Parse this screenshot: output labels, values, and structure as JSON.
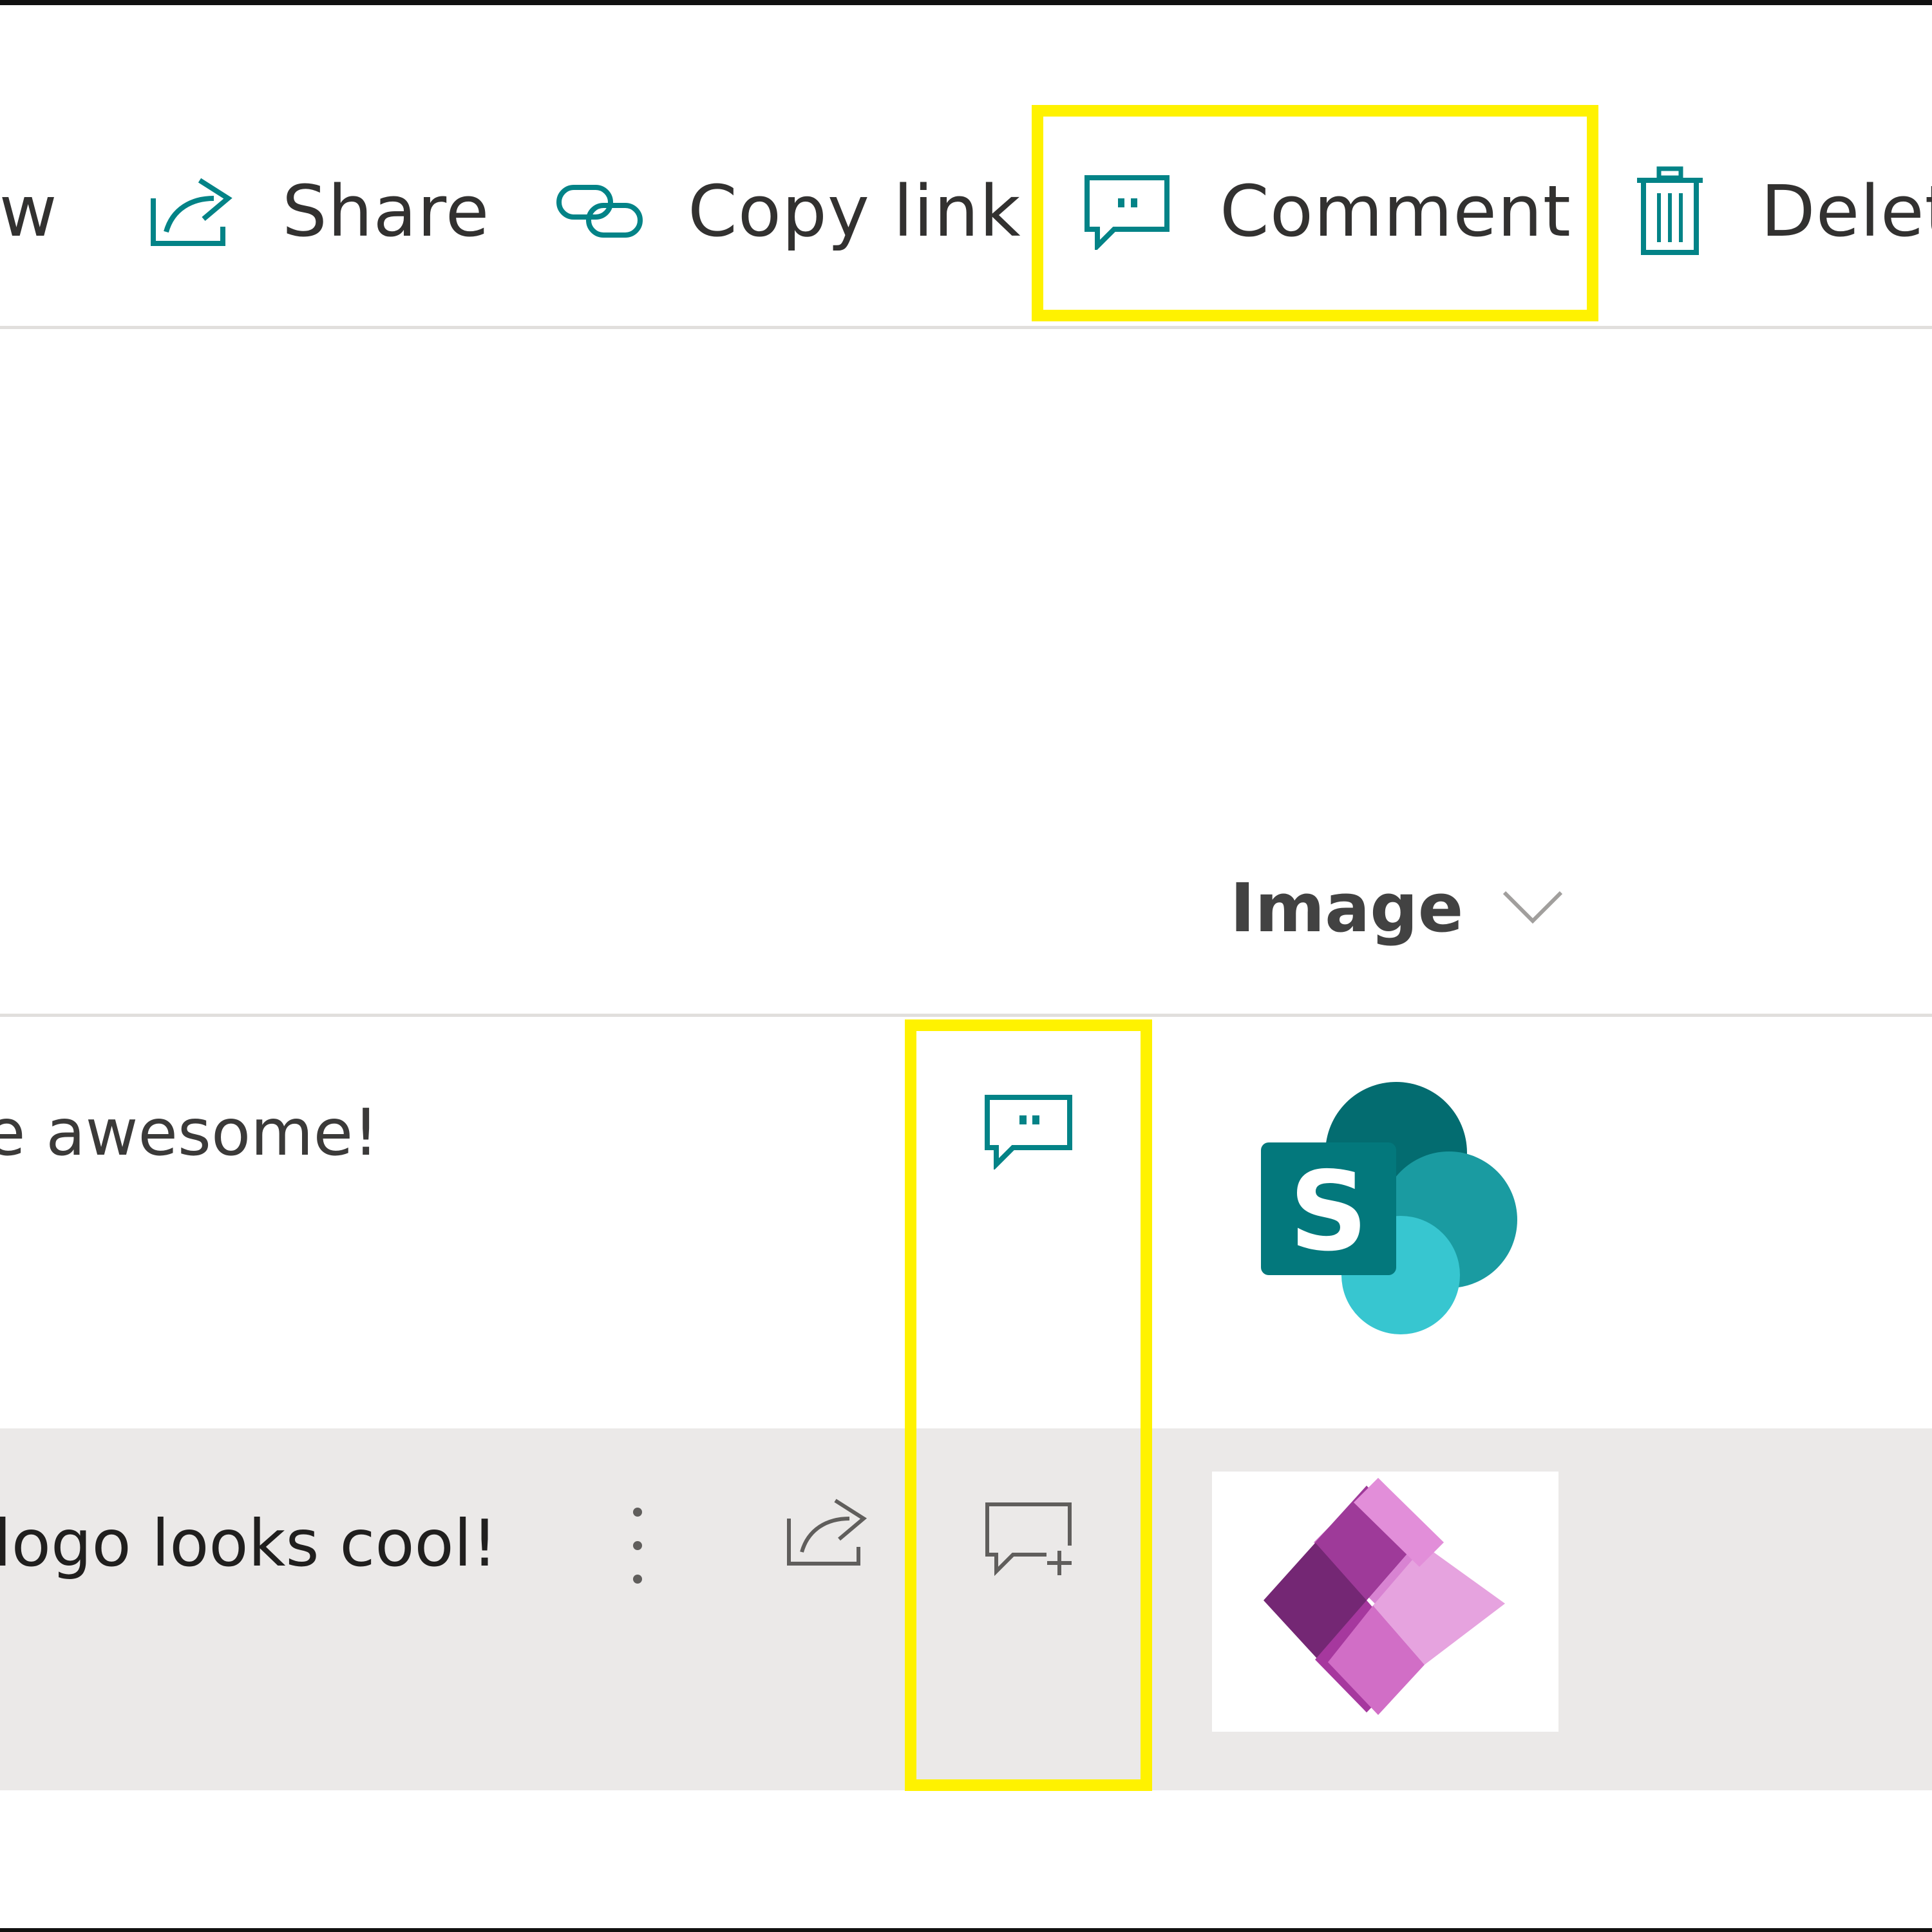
{
  "toolbar": {
    "view_label": "ew",
    "share_label": "Share",
    "copy_link_label": "Copy link",
    "comment_label": "Comment",
    "delete_label": "Delet"
  },
  "list": {
    "columns": {
      "image_header": "Image"
    },
    "rows": [
      {
        "title": "e awesome!",
        "has_comments": true,
        "image": "sharepoint-logo"
      },
      {
        "title": "logo looks cool!",
        "has_comments": false,
        "image": "power-apps-logo"
      }
    ]
  },
  "icons": {
    "share": "share-icon",
    "copy_link": "link-icon",
    "comment": "comment-icon",
    "delete": "trash-icon",
    "sort": "chevron-down-icon",
    "more": "more-vertical-icon",
    "add_comment": "comment-add-icon"
  },
  "colors": {
    "accent": "#038387",
    "highlight": "#fff200",
    "selected_row": "#ebe9e8",
    "icon_gray": "#605e5c"
  }
}
